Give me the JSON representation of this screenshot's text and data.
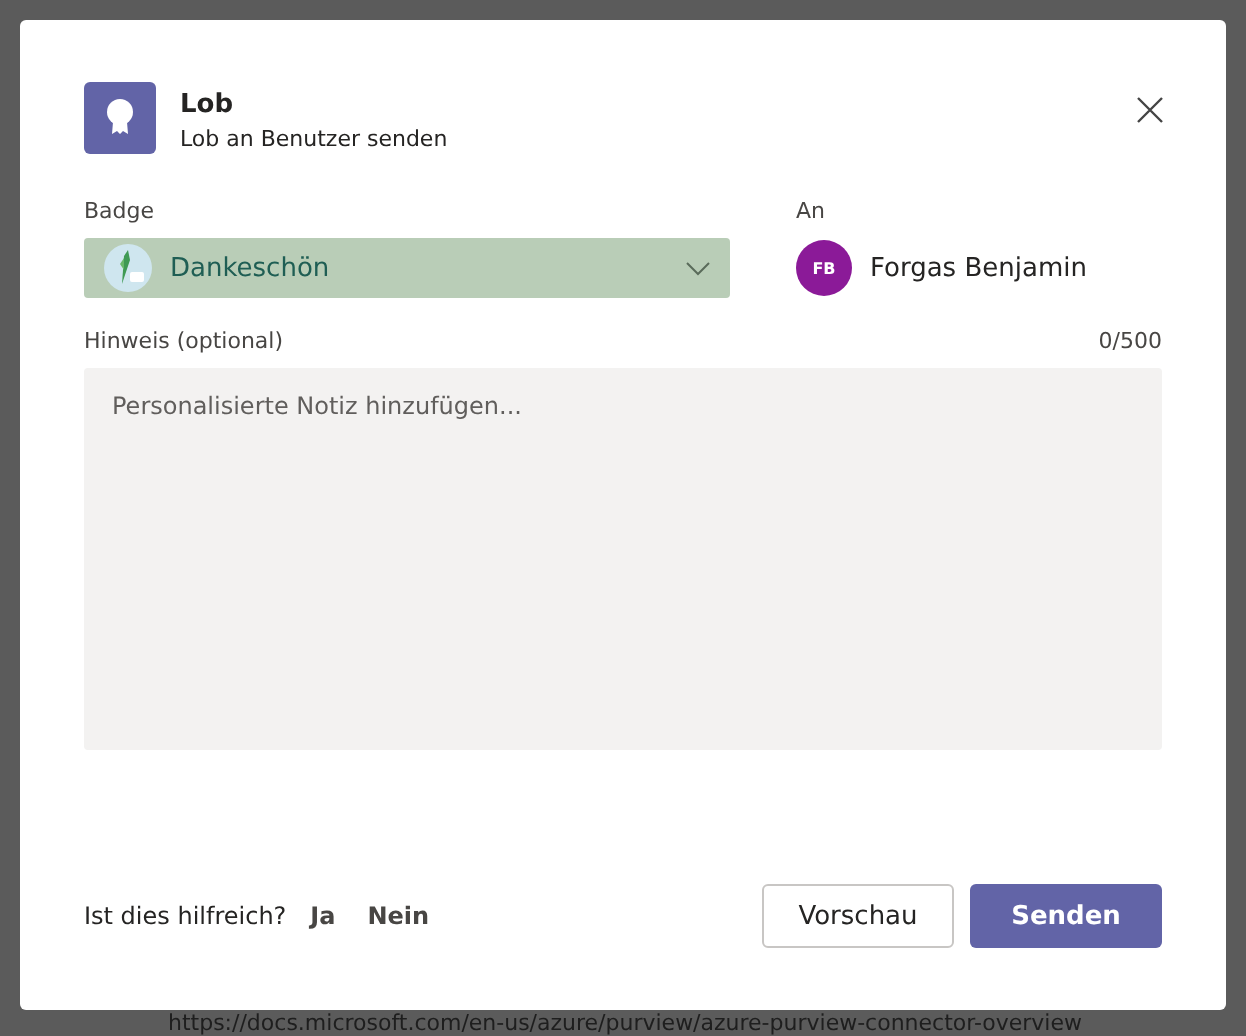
{
  "background": {
    "bottom_text": "https://docs.microsoft.com/en-us/azure/purview/azure-purview-connector-overview"
  },
  "dialog": {
    "title": "Lob",
    "subtitle": "Lob an Benutzer senden",
    "badge": {
      "label": "Badge",
      "value": "Dankeschön"
    },
    "recipient": {
      "label": "An",
      "initials": "FB",
      "name": "Forgas Benjamin"
    },
    "note": {
      "label": "Hinweis (optional)",
      "counter": "0/500",
      "placeholder": "Personalisierte Notiz hinzufügen..."
    },
    "feedback": {
      "question": "Ist dies hilfreich?",
      "options": [
        "Ja",
        "Nein"
      ]
    },
    "buttons": [
      {
        "label": "Vorschau",
        "kind": "secondary"
      },
      {
        "label": "Senden",
        "kind": "primary"
      }
    ]
  }
}
